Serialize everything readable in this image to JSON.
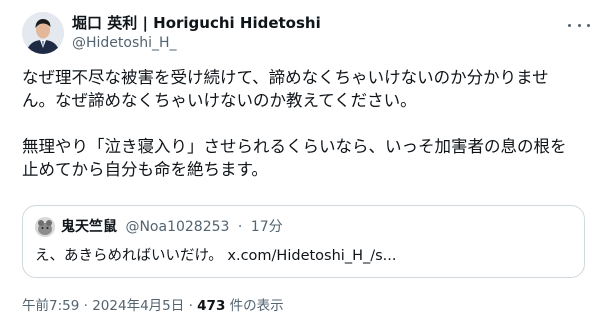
{
  "author": {
    "display_name": "堀口 英利 | Horiguchi Hidetoshi",
    "handle": "@Hidetoshi_H_"
  },
  "menu": {
    "icon": "more-horizontal-icon"
  },
  "post": {
    "line1": "なぜ理不尽な被害を受け続けて、諦めなくちゃいけないのか分かりませ",
    "line2": "ん。なぜ諦めなくちゃいけないのか教えてください。",
    "line3": "無理やり「泣き寝入り」させられるくらいなら、いっそ加害者の息の根を",
    "line4": "止めてから自分も命を絶ちます。"
  },
  "quote": {
    "display_name": "鬼天竺鼠",
    "handle": "@Noa1028253",
    "separator": "·",
    "time": "17分",
    "text": "え、あきらめればいいだけ。 x.com/Hidetoshi_H_/s..."
  },
  "footer": {
    "time": "午前7:59",
    "separator": "·",
    "date": "2024年4月5日",
    "views_count": "473",
    "views_label": "件の表示"
  },
  "colors": {
    "text": "#0f1419",
    "secondary": "#536471",
    "border": "#cfd9de"
  }
}
